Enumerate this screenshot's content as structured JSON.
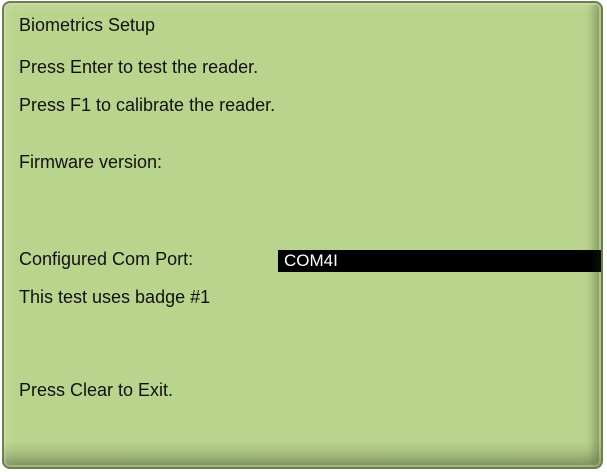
{
  "screen": {
    "title": "Biometrics Setup",
    "enter_instruction": "Press Enter to test the reader.",
    "f1_instruction": "Press F1 to calibrate the reader.",
    "firmware_label": "Firmware version:",
    "com_port_label": "Configured Com Port:",
    "com_port_value": "COM4I",
    "badge_text": "This test uses badge #1",
    "exit_instruction": "Press Clear to Exit."
  },
  "colors": {
    "screen_background": "#b9d48d",
    "text": "#111111",
    "highlight_background": "#000000",
    "highlight_text": "#ffffff"
  }
}
